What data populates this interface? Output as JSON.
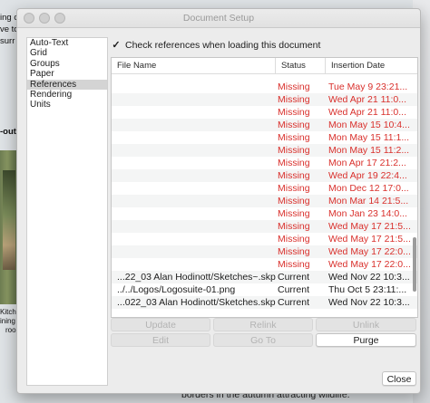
{
  "background": {
    "fragments": [
      "ing c",
      "ve to",
      "surr",
      "-out",
      "Kitch",
      "ining",
      "roo"
    ],
    "bottom_text": "borders in the autumn attracting wildlife."
  },
  "dialog": {
    "title": "Document Setup",
    "sidebar": {
      "items": [
        "Auto-Text",
        "Grid",
        "Groups",
        "Paper",
        "References",
        "Rendering",
        "Units"
      ],
      "selected": "References"
    },
    "check_references": {
      "label": "Check references when loading this document",
      "checked": true,
      "mark": "✓"
    },
    "table": {
      "columns": [
        "File Name",
        "Status",
        "Insertion Date"
      ],
      "rows": [
        {
          "file": "",
          "status": "Missing",
          "date": "Tue May  9 23:21..."
        },
        {
          "file": "",
          "status": "Missing",
          "date": "Wed Apr 21 11:0..."
        },
        {
          "file": "",
          "status": "Missing",
          "date": "Wed Apr 21 11:0..."
        },
        {
          "file": "",
          "status": "Missing",
          "date": "Mon May 15 10:4..."
        },
        {
          "file": "",
          "status": "Missing",
          "date": "Mon May 15 11:1..."
        },
        {
          "file": "",
          "status": "Missing",
          "date": "Mon May 15 11:2..."
        },
        {
          "file": "",
          "status": "Missing",
          "date": "Mon Apr 17 21:2..."
        },
        {
          "file": "",
          "status": "Missing",
          "date": "Wed Apr 19 22:4..."
        },
        {
          "file": "",
          "status": "Missing",
          "date": "Mon Dec 12 17:0..."
        },
        {
          "file": "",
          "status": "Missing",
          "date": "Mon Mar 14 21:5..."
        },
        {
          "file": "",
          "status": "Missing",
          "date": "Mon Jan 23 14:0..."
        },
        {
          "file": "",
          "status": "Missing",
          "date": "Wed May 17 21:5..."
        },
        {
          "file": "",
          "status": "Missing",
          "date": "Wed May 17 21:5..."
        },
        {
          "file": "",
          "status": "Missing",
          "date": "Wed May 17 22:0..."
        },
        {
          "file": "",
          "status": "Missing",
          "date": "Wed May 17 22:0..."
        },
        {
          "file": "...22_03 Alan Hodinott/Sketches~.skp",
          "status": "Current",
          "date": "Wed Nov 22 10:3..."
        },
        {
          "file": "../../Logos/Logosuite-01.png",
          "status": "Current",
          "date": "Thu Oct  5 23:11:..."
        },
        {
          "file": "...022_03 Alan Hodinott/Sketches.skp",
          "status": "Current",
          "date": "Wed Nov 22 10:3..."
        }
      ]
    },
    "buttons": {
      "update": "Update",
      "relink": "Relink",
      "unlink": "Unlink",
      "edit": "Edit",
      "goto": "Go To",
      "purge": "Purge",
      "close": "Close"
    }
  },
  "colors": {
    "missing": "#d9302c",
    "current": "#1c1c1c",
    "selection": "#d4d4d4"
  }
}
